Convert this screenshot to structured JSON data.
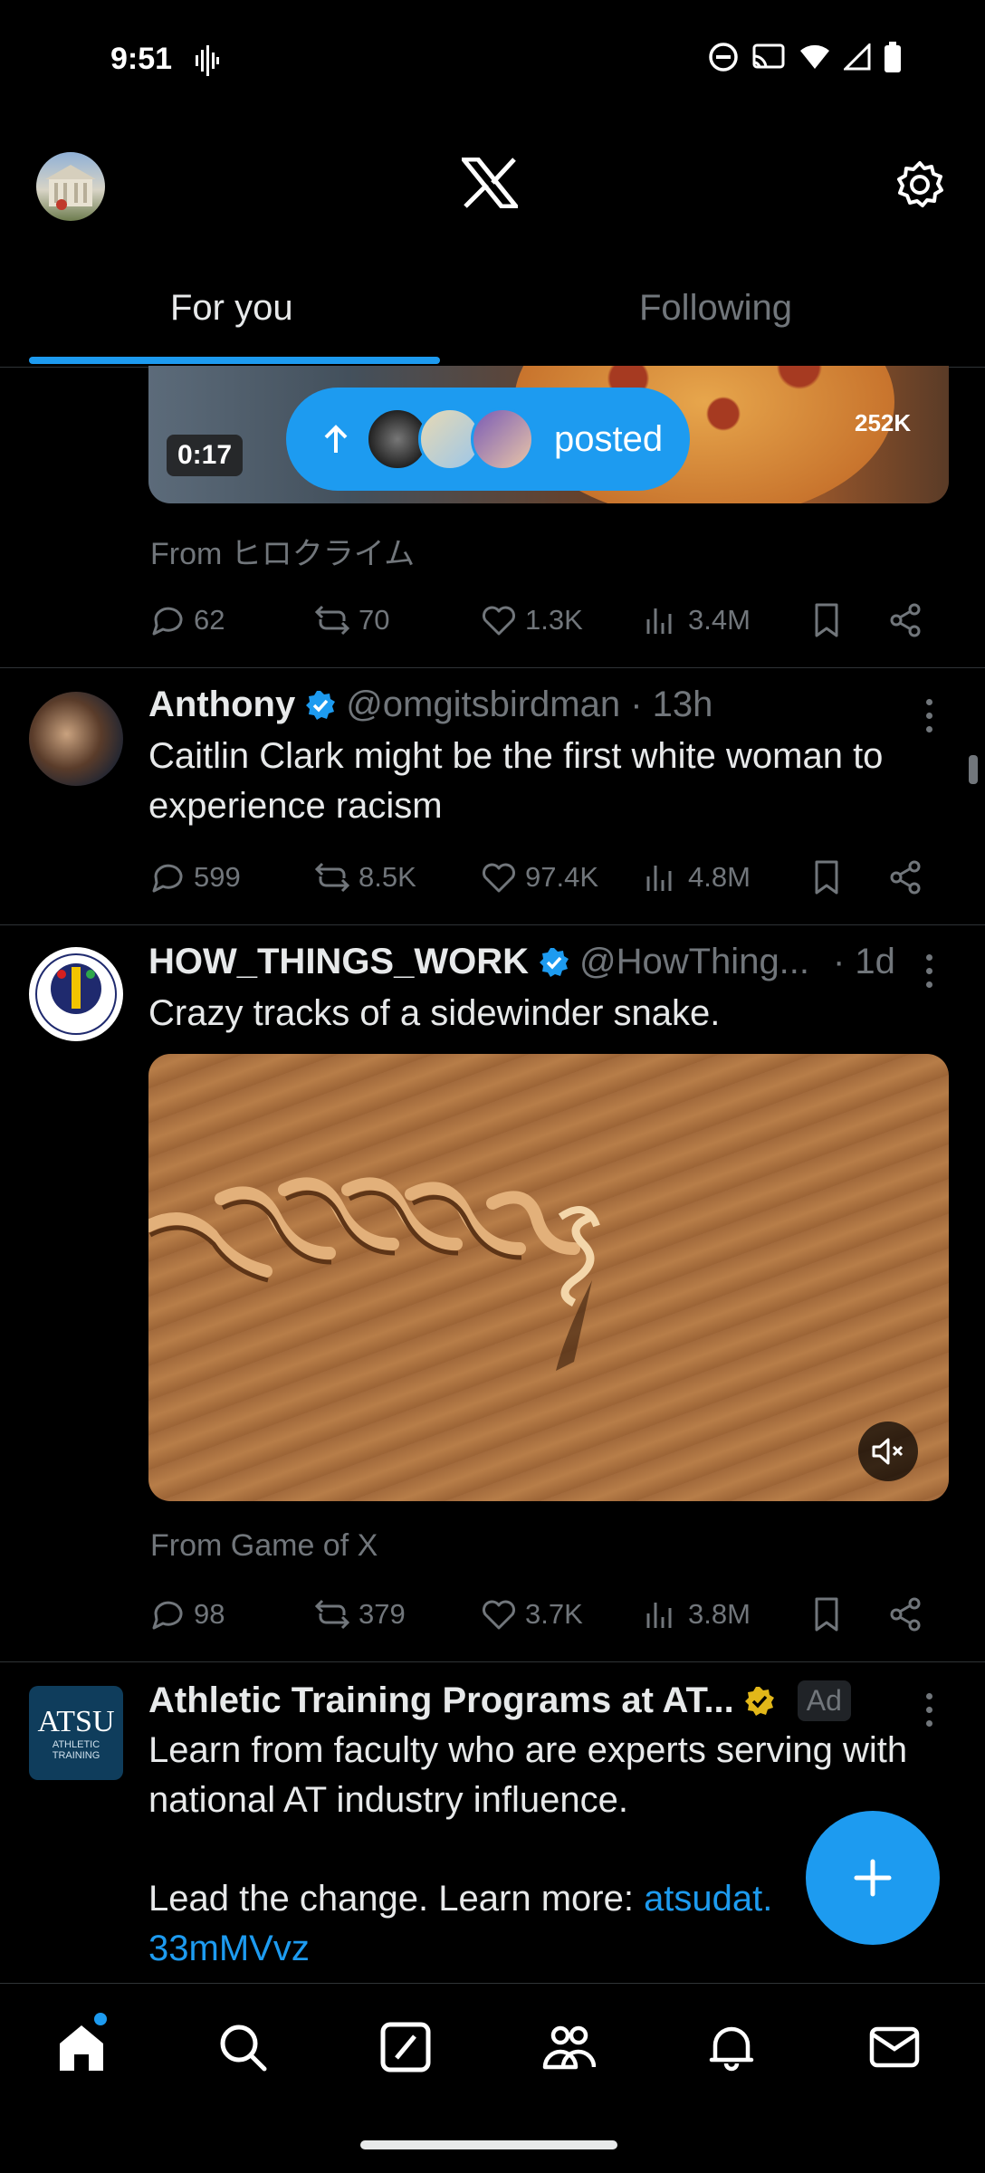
{
  "status_bar": {
    "time": "9:51"
  },
  "header": {
    "tabs": [
      "For you",
      "Following"
    ]
  },
  "post_1": {
    "duration": "0:17",
    "overlay_views": "252K",
    "posted_label": "posted",
    "from_label": "From ヒロクライム",
    "replies": "62",
    "reposts": "70",
    "likes": "1.3K",
    "views": "3.4M"
  },
  "post_2": {
    "name": "Anthony",
    "handle": "@omgitsbirdman · 13h",
    "text": "Caitlin Clark might be the first white woman to experience racism",
    "replies": "599",
    "reposts": "8.5K",
    "likes": "97.4K",
    "views": "4.8M"
  },
  "post_3": {
    "name": "HOW_THINGS_WORK",
    "handle": "@HowThing...",
    "time": "· 1d",
    "text": "Crazy tracks of a sidewinder snake.",
    "from_label": "From Game of X",
    "replies": "98",
    "reposts": "379",
    "likes": "3.7K",
    "views": "3.8M"
  },
  "post_4": {
    "name": "Athletic Training Programs at AT...",
    "ad_label": "Ad",
    "avatar_text": "ATSU",
    "avatar_sub_1": "ATHLETIC",
    "avatar_sub_2": "TRAINING",
    "text_1": "Learn from faculty who are experts serving with national AT industry influence.",
    "text_2": "Lead the change. Learn more: ",
    "link_1": "atsudat.",
    "link_2": "33mMVvz"
  },
  "icons": [
    "search-icon",
    "home-icon",
    "grok-icon",
    "communities-icon",
    "notifications-icon",
    "messages-icon"
  ],
  "colors": {
    "accent": "#1d9bf0",
    "verified": "#1d9bf0",
    "gold_verified": "#e2b719"
  }
}
